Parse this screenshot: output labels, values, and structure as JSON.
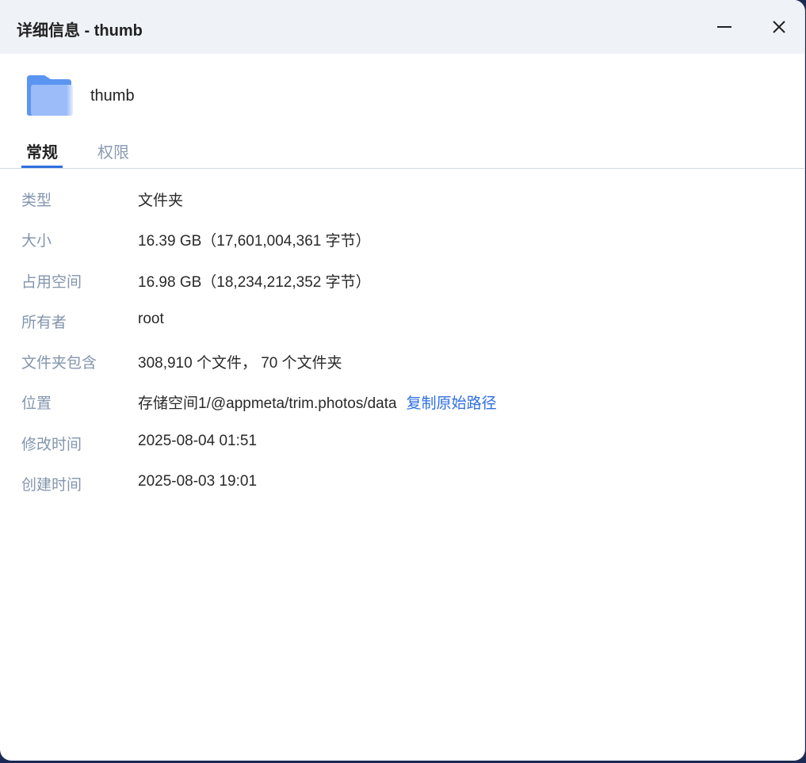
{
  "window": {
    "title": "详细信息 - thumb"
  },
  "header": {
    "name": "thumb",
    "icon": "folder-icon"
  },
  "tabs": [
    {
      "label": "常规",
      "active": true
    },
    {
      "label": "权限",
      "active": false
    }
  ],
  "rows": [
    {
      "label": "类型",
      "value": "文件夹"
    },
    {
      "label": "大小",
      "value": "16.39 GB（17,601,004,361 字节）"
    },
    {
      "label": "占用空间",
      "value": "16.98 GB（18,234,212,352 字节）"
    },
    {
      "label": "所有者",
      "value": "root"
    },
    {
      "label": "文件夹包含",
      "value": "308,910 个文件， 70 个文件夹"
    },
    {
      "label": "位置",
      "value": "存储空间1/@appmeta/trim.photos/data",
      "link": "复制原始路径"
    },
    {
      "label": "修改时间",
      "value": "2025-08-04 01:51"
    },
    {
      "label": "创建时间",
      "value": "2025-08-03 19:01"
    }
  ],
  "colors": {
    "accent": "#2f6fe0",
    "titlebar": "#eff2f7",
    "label": "#8395ad"
  }
}
